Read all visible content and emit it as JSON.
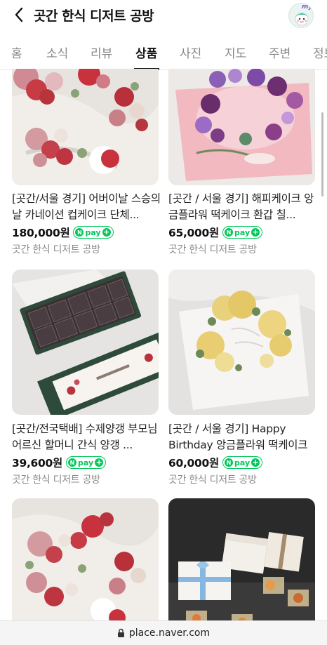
{
  "header": {
    "title": "곳간 한식 디저트 공방",
    "avatar_label": "my"
  },
  "tabs": [
    {
      "label": "홈",
      "active": false
    },
    {
      "label": "소식",
      "active": false
    },
    {
      "label": "리뷰",
      "active": false
    },
    {
      "label": "상품",
      "active": true
    },
    {
      "label": "사진",
      "active": false
    },
    {
      "label": "지도",
      "active": false
    },
    {
      "label": "주변",
      "active": false
    },
    {
      "label": "정보",
      "active": false
    }
  ],
  "products": [
    {
      "title": "[곳간/서울 경기] 어버이날 스승의날 카네이션 컵케이크 단체...",
      "price": "180,000원",
      "npay": true,
      "shop": "곳간 한식 디저트 공방",
      "image": "carnation-cupcakes-photo"
    },
    {
      "title": "[곳간 / 서울 경기] 해피케이크 앙금플라워 떡케이크 환갑 칠...",
      "price": "65,000원",
      "npay": true,
      "shop": "곳간 한식 디저트 공방",
      "image": "purple-flower-rice-cake-photo"
    },
    {
      "title": "[곳간/전국택배] 수제양갱 부모님 어르신 할머니 간식 양갱 ...",
      "price": "39,600원",
      "npay": true,
      "shop": "곳간 한식 디저트 공방",
      "image": "yanggaeng-gift-box-photo"
    },
    {
      "title": "[곳간 / 서울 경기] Happy Birthday 앙금플라워 떡케이크 ...",
      "price": "60,000원",
      "npay": true,
      "shop": "곳간 한식 디저트 공방",
      "image": "yellow-flower-rice-cake-photo"
    },
    {
      "title": "",
      "price": "",
      "npay": false,
      "shop": "",
      "image": "carnation-cupcakes-photo"
    },
    {
      "title": "",
      "price": "",
      "npay": false,
      "shop": "",
      "image": "gift-boxes-cookies-photo"
    }
  ],
  "npay_badge": {
    "n": "N",
    "pay": "pay",
    "plus": "+"
  },
  "browser": {
    "url": "place.naver.com"
  },
  "colors": {
    "npay_green": "#03c75a",
    "text_primary": "#111111",
    "text_secondary": "#8a8a8a",
    "active_tab": "#111111",
    "inactive_tab": "#888888"
  }
}
